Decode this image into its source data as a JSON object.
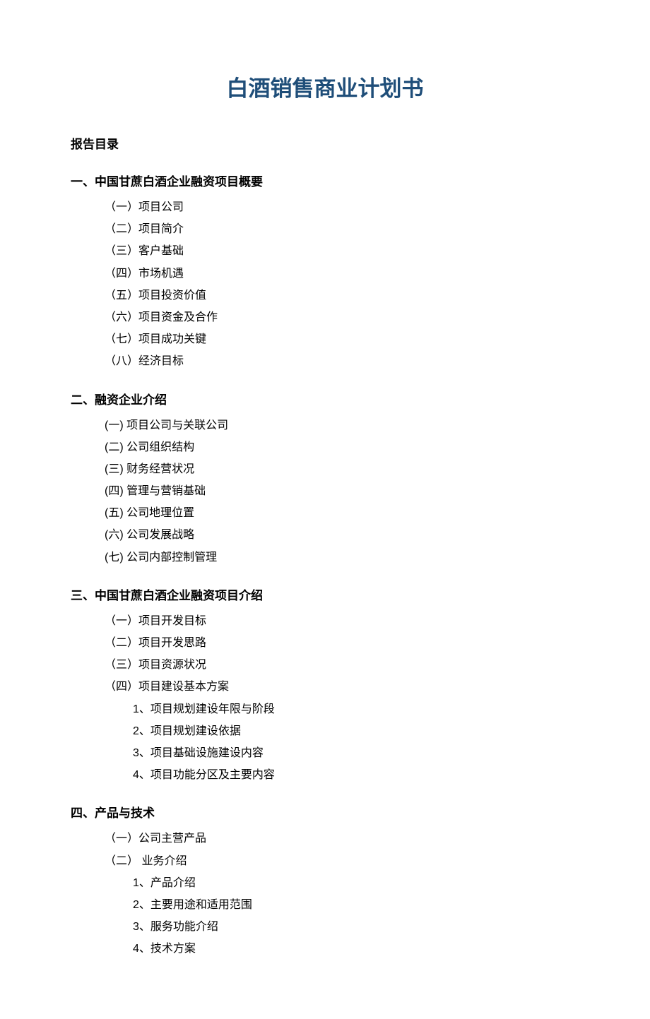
{
  "title": "白酒销售商业计划书",
  "toc_header": "报告目录",
  "sections": [
    {
      "heading": "一、中国甘蔗白酒企业融资项目概要",
      "items": [
        "（一）项目公司",
        "（二）项目简介",
        "（三）客户基础",
        "（四）市场机遇",
        "（五）项目投资价值",
        "（六）项目资金及合作",
        "（七）项目成功关键",
        "（八）经济目标"
      ]
    },
    {
      "heading": "二、融资企业介绍",
      "items": [
        "(一) 项目公司与关联公司",
        "(二) 公司组织结构",
        "(三) 财务经营状况",
        "(四) 管理与营销基础",
        "(五) 公司地理位置",
        "(六) 公司发展战略",
        "(七) 公司内部控制管理"
      ]
    },
    {
      "heading": "三、中国甘蔗白酒企业融资项目介绍",
      "items": [
        "（一）项目开发目标",
        "（二）项目开发思路",
        "（三）项目资源状况",
        "（四）项目建设基本方案"
      ],
      "sub_items": [
        "1、项目规划建设年限与阶段",
        "2、项目规划建设依据",
        "3、项目基础设施建设内容",
        "4、项目功能分区及主要内容"
      ]
    },
    {
      "heading": "四、产品与技术",
      "items": [
        "（一）公司主营产品",
        "（二） 业务介绍"
      ],
      "sub_items": [
        "1、产品介绍",
        "2、主要用途和适用范围",
        "3、服务功能介绍",
        "4、技术方案"
      ]
    }
  ]
}
